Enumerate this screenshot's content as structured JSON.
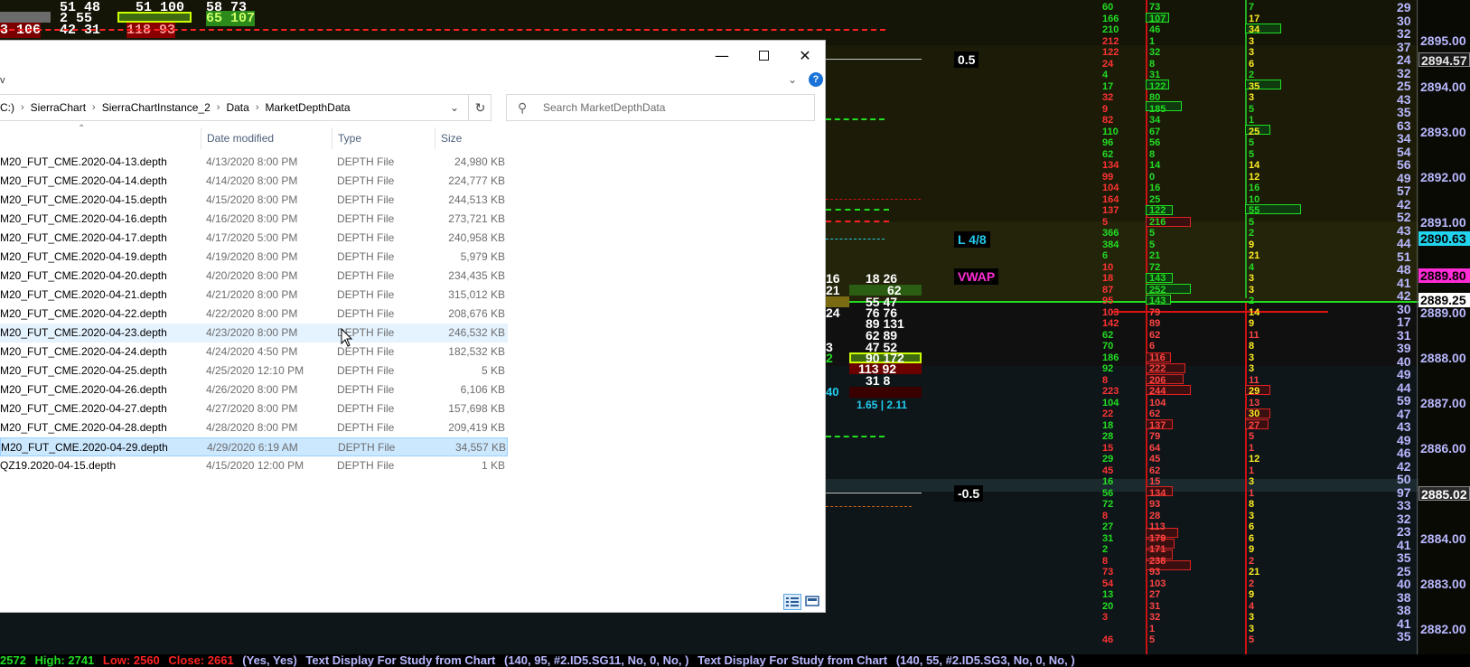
{
  "explorer": {
    "title_fragment": "v",
    "breadcrumbs": [
      "C:)",
      "SierraChart",
      "SierraChartInstance_2",
      "Data",
      "MarketDepthData"
    ],
    "search_placeholder": "Search MarketDepthData",
    "columns": {
      "date": "Date modified",
      "type": "Type",
      "size": "Size"
    },
    "files": [
      {
        "name": "M20_FUT_CME.2020-04-13.depth",
        "date": "4/13/2020 8:00 PM",
        "type": "DEPTH File",
        "size": "24,980 KB"
      },
      {
        "name": "M20_FUT_CME.2020-04-14.depth",
        "date": "4/14/2020 8:00 PM",
        "type": "DEPTH File",
        "size": "224,777 KB"
      },
      {
        "name": "M20_FUT_CME.2020-04-15.depth",
        "date": "4/15/2020 8:00 PM",
        "type": "DEPTH File",
        "size": "244,513 KB"
      },
      {
        "name": "M20_FUT_CME.2020-04-16.depth",
        "date": "4/16/2020 8:00 PM",
        "type": "DEPTH File",
        "size": "273,721 KB"
      },
      {
        "name": "M20_FUT_CME.2020-04-17.depth",
        "date": "4/17/2020 5:00 PM",
        "type": "DEPTH File",
        "size": "240,958 KB"
      },
      {
        "name": "M20_FUT_CME.2020-04-19.depth",
        "date": "4/19/2020 8:00 PM",
        "type": "DEPTH File",
        "size": "5,979 KB"
      },
      {
        "name": "M20_FUT_CME.2020-04-20.depth",
        "date": "4/20/2020 8:00 PM",
        "type": "DEPTH File",
        "size": "234,435 KB"
      },
      {
        "name": "M20_FUT_CME.2020-04-21.depth",
        "date": "4/21/2020 8:00 PM",
        "type": "DEPTH File",
        "size": "315,012 KB"
      },
      {
        "name": "M20_FUT_CME.2020-04-22.depth",
        "date": "4/22/2020 8:00 PM",
        "type": "DEPTH File",
        "size": "208,676 KB"
      },
      {
        "name": "M20_FUT_CME.2020-04-23.depth",
        "date": "4/23/2020 8:00 PM",
        "type": "DEPTH File",
        "size": "246,532 KB"
      },
      {
        "name": "M20_FUT_CME.2020-04-24.depth",
        "date": "4/24/2020 4:50 PM",
        "type": "DEPTH File",
        "size": "182,532 KB"
      },
      {
        "name": "M20_FUT_CME.2020-04-25.depth",
        "date": "4/25/2020 12:10 PM",
        "type": "DEPTH File",
        "size": "5 KB"
      },
      {
        "name": "M20_FUT_CME.2020-04-26.depth",
        "date": "4/26/2020 8:00 PM",
        "type": "DEPTH File",
        "size": "6,106 KB"
      },
      {
        "name": "M20_FUT_CME.2020-04-27.depth",
        "date": "4/27/2020 8:00 PM",
        "type": "DEPTH File",
        "size": "157,698 KB"
      },
      {
        "name": "M20_FUT_CME.2020-04-28.depth",
        "date": "4/28/2020 8:00 PM",
        "type": "DEPTH File",
        "size": "209,419 KB"
      },
      {
        "name": "M20_FUT_CME.2020-04-29.depth",
        "date": "4/29/2020 6:19 AM",
        "type": "DEPTH File",
        "size": "34,557 KB"
      },
      {
        "name": "QZ19.2020-04-15.depth",
        "date": "4/15/2020 12:00 PM",
        "type": "DEPTH File",
        "size": "1 KB"
      }
    ],
    "hover_row": 9,
    "selected_row": 15
  },
  "chart": {
    "top_fragments": [
      "51 48",
      "51 100",
      "58 73",
      "2 55",
      "65 107",
      "3 106",
      "42 31",
      "118 93"
    ],
    "labels": {
      "level_pos": "0.5",
      "level_neg": "-0.5",
      "l48": "L 4/8",
      "vwap": "VWAP",
      "ratio": "1.65 | 2.11",
      "left_40": "40"
    },
    "mid_pairs": [
      "18 26",
      "62",
      "55 47",
      "76 76",
      "89 131",
      "62 89",
      "47 52",
      "90 172",
      "113 92",
      "31 8"
    ],
    "left_edge_digits": [
      "16",
      "21",
      "24",
      "3",
      "2"
    ],
    "price_axis": [
      "2895.00",
      "2894.00",
      "2893.00",
      "2892.00",
      "2891.00",
      "2889.00",
      "2888.00",
      "2887.00",
      "2886.00",
      "2884.00",
      "2883.00",
      "2882.00"
    ],
    "price_boxes": [
      {
        "text": "2894.57",
        "color": "#e6e6e6",
        "bg": "#1a1a1a"
      },
      {
        "text": "2890.63",
        "color": "#000000",
        "bg": "#22d3ee"
      },
      {
        "text": "2889.80",
        "color": "#000000",
        "bg": "#ff2bd6"
      },
      {
        "text": "2889.25",
        "color": "#000000",
        "bg": "#ffffff"
      },
      {
        "text": "2885.02",
        "color": "#ffffff",
        "bg": "#2a2a2a"
      }
    ],
    "col_a": [
      "60",
      "166",
      "210",
      "212",
      "122",
      "24",
      "4",
      "17",
      "32",
      "9",
      "82",
      "110",
      "96",
      "62",
      "134",
      "99",
      "104",
      "164",
      "137",
      "5",
      "366",
      "384",
      "6",
      "10",
      "18",
      "87",
      "95",
      "103",
      "142",
      "62",
      "70",
      "186",
      "92",
      "8",
      "223",
      "104",
      "22",
      "18",
      "28",
      "15",
      "29",
      "45",
      "16",
      "56",
      "72",
      "8",
      "27",
      "31",
      "2",
      "8",
      "73",
      "54",
      "13",
      "20",
      "3",
      "",
      "46"
    ],
    "col_b": [
      "73",
      "107",
      "46",
      "1",
      "32",
      "8",
      "31",
      "122",
      "80",
      "185",
      "34",
      "67",
      "56",
      "8",
      "14",
      "0",
      "16",
      "25",
      "122",
      "216",
      "5",
      "5",
      "21",
      "72",
      "143",
      "252",
      "143",
      "79",
      "89",
      "62",
      "6",
      "116",
      "222",
      "206",
      "244",
      "104",
      "62",
      "137",
      "79",
      "64",
      "45",
      "62",
      "15",
      "134",
      "93",
      "28",
      "113",
      "179",
      "171",
      "238",
      "93",
      "103",
      "27",
      "31",
      "32",
      "1",
      "5"
    ],
    "col_c": [
      "7",
      "17",
      "34",
      "3",
      "3",
      "6",
      "2",
      "35",
      "3",
      "5",
      "1",
      "25",
      "5",
      "5",
      "14",
      "12",
      "16",
      "10",
      "55",
      "5",
      "2",
      "9",
      "21",
      "4",
      "3",
      "3",
      "2",
      "14",
      "9",
      "11",
      "8",
      "3",
      "3",
      "11",
      "29",
      "13",
      "30",
      "27",
      "5",
      "1",
      "12",
      "1",
      "3",
      "1",
      "8",
      "3",
      "6",
      "6",
      "9",
      "2",
      "21",
      "2",
      "9",
      "4",
      "3",
      "3",
      "5"
    ],
    "col_d": [
      "29",
      "30",
      "32",
      "37",
      "24",
      "32",
      "25",
      "43",
      "35",
      "63",
      "34",
      "54",
      "56",
      "49",
      "57",
      "42",
      "52",
      "43",
      "44",
      "51",
      "48",
      "41",
      "42",
      "30",
      "17",
      "31",
      "39",
      "40",
      "49",
      "44",
      "59",
      "47",
      "43",
      "49",
      "46",
      "42",
      "50",
      "97",
      "33",
      "32",
      "23",
      "41",
      "35",
      "25",
      "40",
      "38",
      "38",
      "41",
      "35"
    ],
    "status": {
      "first": "2572",
      "high": "High: 2741",
      "low": "Low: 2560",
      "close": "Close: 2661",
      "yes": "(Yes, Yes)",
      "text1": "Text Display For Study from Chart",
      "args1": "(140, 95, #2.ID5.SG11, No, 0, No, )",
      "text2": "Text Display For Study from Chart",
      "args2": "(140, 55, #2.ID5.SG3, No, 0, No, )"
    }
  }
}
